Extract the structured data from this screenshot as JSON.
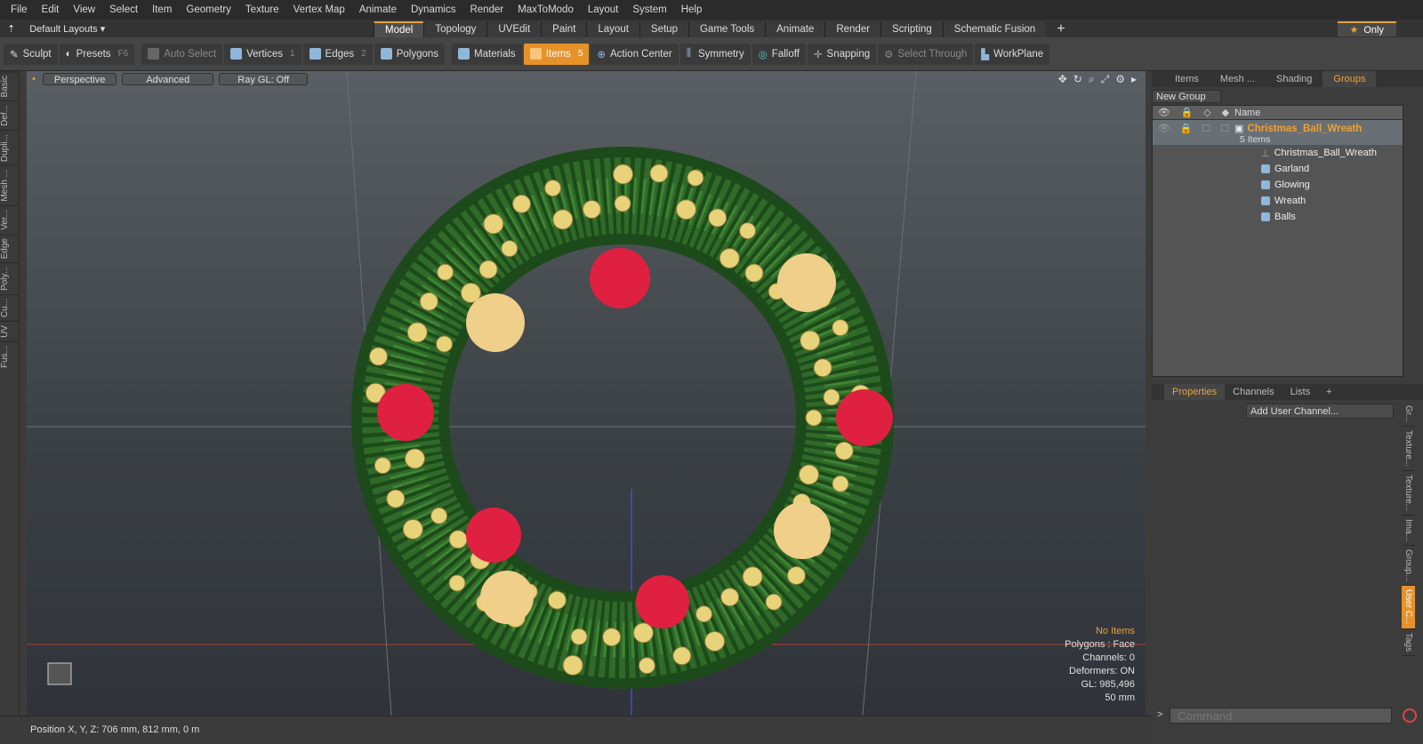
{
  "menu": [
    "File",
    "Edit",
    "View",
    "Select",
    "Item",
    "Geometry",
    "Texture",
    "Vertex Map",
    "Animate",
    "Dynamics",
    "Render",
    "MaxToModo",
    "Layout",
    "System",
    "Help"
  ],
  "layouts": {
    "label": "Default Layouts ▾"
  },
  "tabs": [
    "Model",
    "Topology",
    "UVEdit",
    "Paint",
    "Layout",
    "Setup",
    "Game Tools",
    "Animate",
    "Render",
    "Scripting",
    "Schematic Fusion"
  ],
  "active_tab": "Model",
  "only_label": "Only",
  "toolbar": {
    "sculpt": "Sculpt",
    "presets": "Presets",
    "presets_key": "F6",
    "auto_select": "Auto Select",
    "vertices": "Vertices",
    "vertices_key": "1",
    "edges": "Edges",
    "edges_key": "2",
    "polygons": "Polygons",
    "materials": "Materials",
    "items": "Items",
    "items_key": "5",
    "action_center": "Action Center",
    "symmetry": "Symmetry",
    "falloff": "Falloff",
    "snapping": "Snapping",
    "select_through": "Select Through",
    "workplane": "WorkPlane"
  },
  "left_tabs": [
    "Basic",
    "Def...",
    "Dupli...",
    "Mesh ...",
    "Ver...",
    "Edge",
    "Poly...",
    "Cu...",
    "UV",
    "Fus..."
  ],
  "viewport": {
    "perspective": "Perspective",
    "advanced": "Advanced",
    "raygl": "Ray GL: Off",
    "stats": {
      "items": "No Items",
      "polygons": "Polygons : Face",
      "channels": "Channels: 0",
      "deformers": "Deformers: ON",
      "gl": "GL: 985,496",
      "scale": "50 mm"
    }
  },
  "status": {
    "position": "Position X, Y, Z:  706 mm, 812 mm, 0 m"
  },
  "right_tabs": [
    "Items",
    "Mesh ...",
    "Shading",
    "Groups"
  ],
  "right_active": "Groups",
  "new_group": "New Group",
  "tree": {
    "name_header": "Name",
    "group_name": "Christmas_Ball_Wreath",
    "group_count": "5 Items",
    "items": [
      "Christmas_Ball_Wreath",
      "Garland",
      "Glowing",
      "Wreath",
      "Balls"
    ]
  },
  "prop_tabs": [
    "Properties",
    "Channels",
    "Lists"
  ],
  "add_user_channel": "Add User Channel...",
  "right_vtabs": [
    "Gr...",
    "Texture...",
    "Texture...",
    "Ima...",
    "Group...",
    "User C...",
    "Tags"
  ],
  "command_placeholder": "Command",
  "colors": {
    "accent": "#e6922a",
    "group_name": "#f0a030"
  }
}
